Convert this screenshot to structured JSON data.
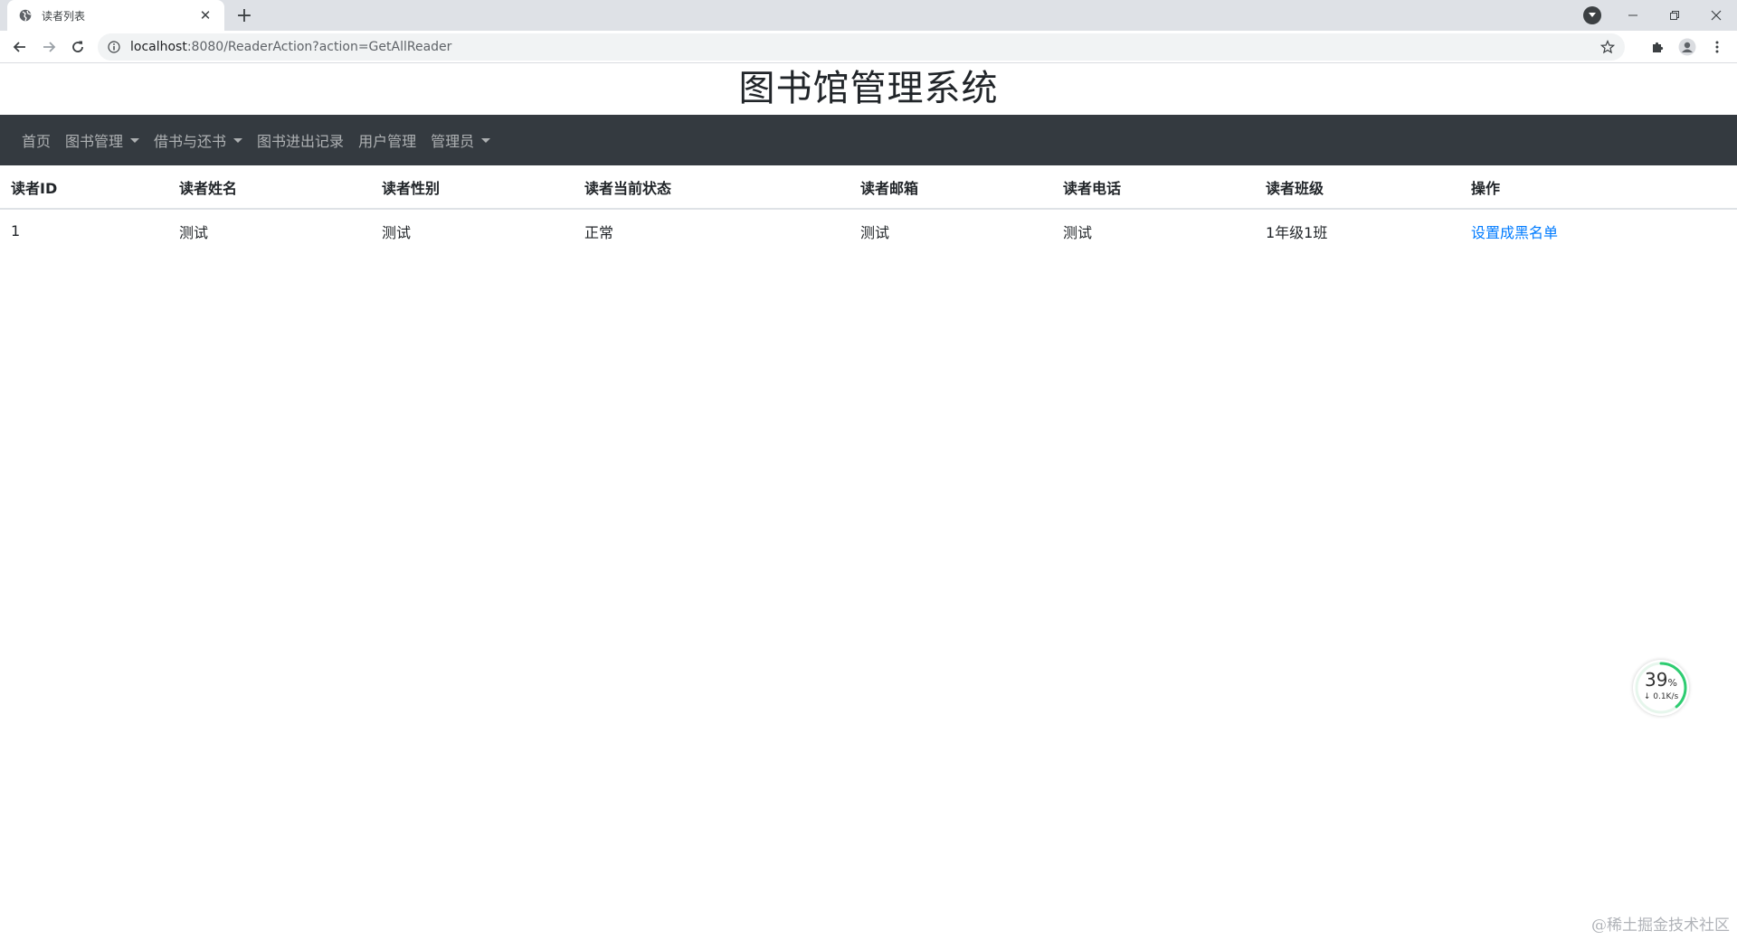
{
  "browser": {
    "tab_title": "读者列表",
    "url_host": "localhost",
    "url_rest": ":8080/ReaderAction?action=GetAllReader",
    "icons": {
      "favicon": "globe-icon",
      "tab_close": "close-icon",
      "new_tab": "plus-icon",
      "tab_search": "chevron-down-icon",
      "minimize": "minimize-icon",
      "restore": "restore-icon",
      "close_window": "close-icon",
      "back": "back-arrow-icon",
      "forward": "forward-arrow-icon",
      "reload": "reload-icon",
      "site_info": "info-icon",
      "bookmark": "star-icon",
      "extensions": "puzzle-icon",
      "profile": "profile-icon",
      "menu": "kebab-menu-icon"
    }
  },
  "page": {
    "title": "图书馆管理系统",
    "nav": [
      {
        "label": "首页",
        "dropdown": false
      },
      {
        "label": "图书管理",
        "dropdown": true
      },
      {
        "label": "借书与还书",
        "dropdown": true
      },
      {
        "label": "图书进出记录",
        "dropdown": false
      },
      {
        "label": "用户管理",
        "dropdown": false
      },
      {
        "label": "管理员",
        "dropdown": true
      }
    ],
    "table": {
      "headers": [
        "读者ID",
        "读者姓名",
        "读者性别",
        "读者当前状态",
        "读者邮箱",
        "读者电话",
        "读者班级",
        "操作"
      ],
      "rows": [
        {
          "id": "1",
          "name": "测试",
          "gender": "测试",
          "status": "正常",
          "email": "测试",
          "phone": "测试",
          "class": "1年级1班",
          "action": "设置成黑名单"
        }
      ]
    }
  },
  "speed_widget": {
    "percent": "39",
    "percent_unit": "%",
    "rate": "0.1K/s",
    "level": 0.39
  },
  "watermark": "@稀土掘金技术社区",
  "colors": {
    "navbar_bg": "#343a40",
    "link": "#007bff",
    "gauge": "#2ecc71"
  }
}
